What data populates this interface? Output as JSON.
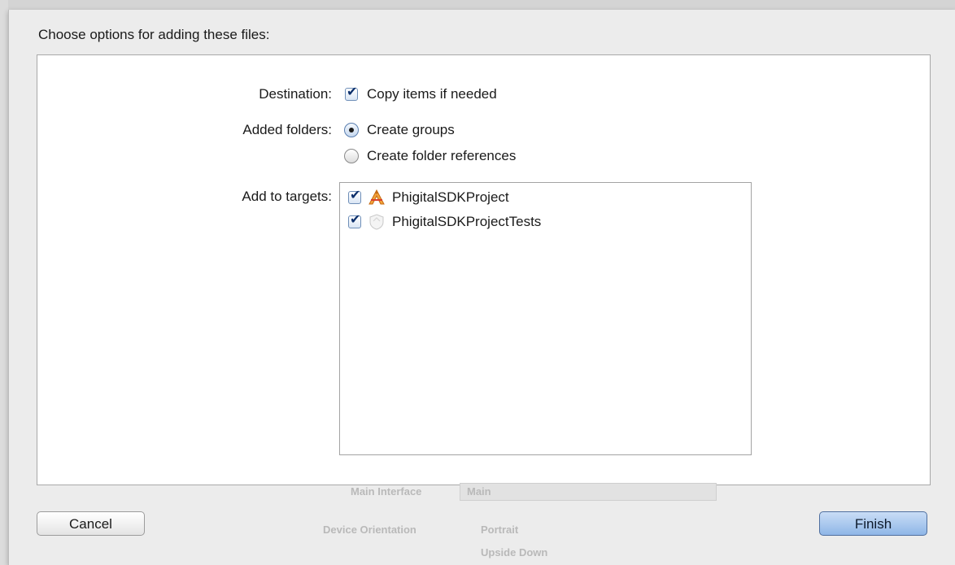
{
  "dialog": {
    "title": "Choose options for adding these files:"
  },
  "destination": {
    "label": "Destination:",
    "copy_items": {
      "label": "Copy items if needed",
      "checked": true
    }
  },
  "added_folders": {
    "label": "Added folders:",
    "options": [
      {
        "label": "Create groups",
        "selected": true
      },
      {
        "label": "Create folder references",
        "selected": false
      }
    ]
  },
  "targets": {
    "label": "Add to targets:",
    "items": [
      {
        "label": "PhigitalSDKProject",
        "checked": true,
        "icon": "app-target-icon"
      },
      {
        "label": "PhigitalSDKProjectTests",
        "checked": true,
        "icon": "test-target-icon"
      }
    ]
  },
  "buttons": {
    "cancel": "Cancel",
    "finish": "Finish"
  },
  "background": {
    "main_interface_label": "Main Interface",
    "main_interface_value": "Main",
    "device_orientation_label": "Device Orientation",
    "portrait": "Portrait",
    "upside_down": "Upside Down"
  },
  "colors": {
    "accent": "#8fb6e7",
    "checkmark": "#0c2f6b"
  }
}
